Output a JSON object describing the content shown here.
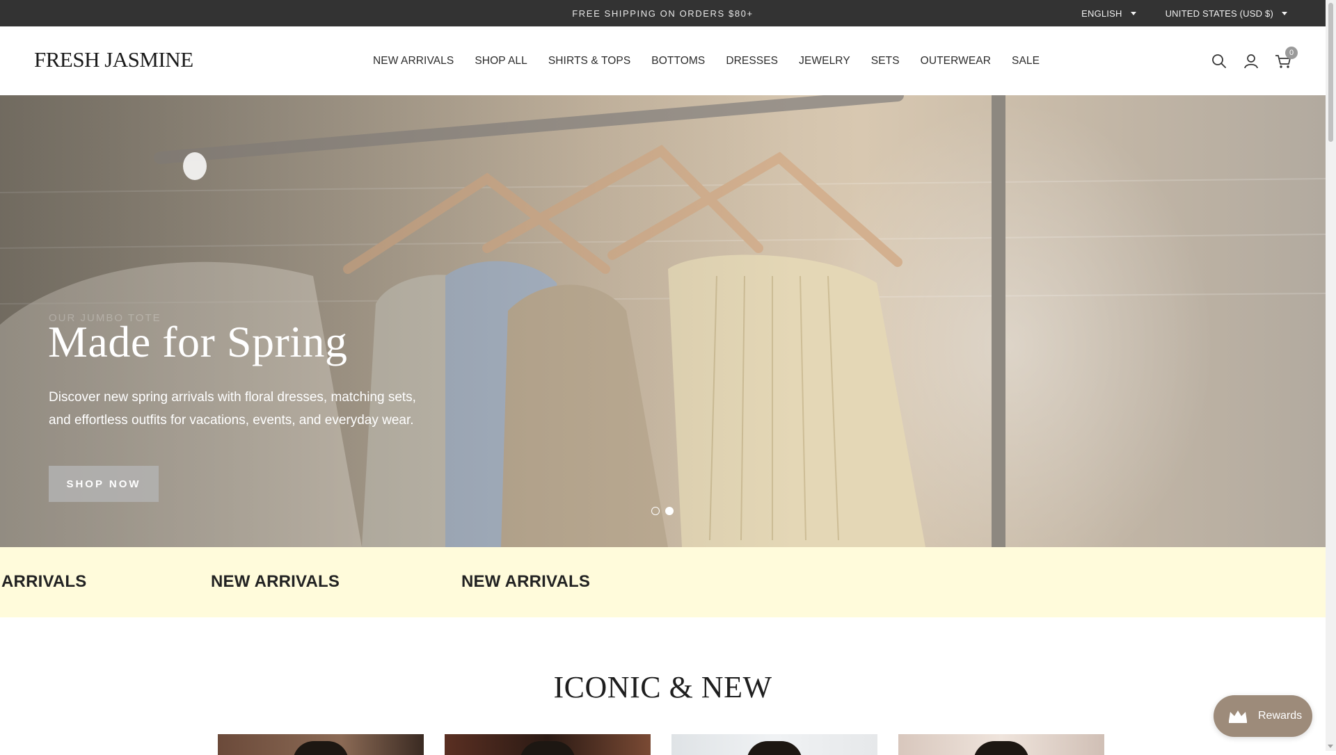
{
  "announcement": {
    "message": "FREE SHIPPING ON ORDERS $80+",
    "language": "ENGLISH",
    "country": "UNITED STATES (USD $)"
  },
  "header": {
    "logo": "FRESH JASMINE",
    "nav": [
      {
        "label": "NEW ARRIVALS"
      },
      {
        "label": "SHOP ALL"
      },
      {
        "label": "SHIRTS & TOPS"
      },
      {
        "label": "BOTTOMS"
      },
      {
        "label": "DRESSES"
      },
      {
        "label": "JEWELRY"
      },
      {
        "label": "SETS"
      },
      {
        "label": "OUTERWEAR"
      },
      {
        "label": "SALE"
      }
    ],
    "icons": [
      "search-icon",
      "account-icon",
      "cart-icon"
    ],
    "cart_count": "0"
  },
  "hero": {
    "eyebrow": "OUR JUMBO TOTE",
    "title": "Made for Spring",
    "subtitle": "Discover new spring arrivals with floral dresses, matching sets, and effortless outfits for vacations, events, and everyday wear.",
    "button_label": "SHOP NOW",
    "slides_total": 2,
    "slide_active": 2
  },
  "marquee": {
    "items": [
      "ARRIVALS",
      "NEW ARRIVALS",
      "NEW ARRIVALS"
    ],
    "background": "#fffbdb"
  },
  "section": {
    "title": "ICONIC & NEW"
  },
  "rewards": {
    "label": "Rewards",
    "icon": "crown-icon",
    "color": "#9d8b7a"
  },
  "colors": {
    "announcement_bg": "#333333",
    "accent": "#9d8b7a"
  }
}
